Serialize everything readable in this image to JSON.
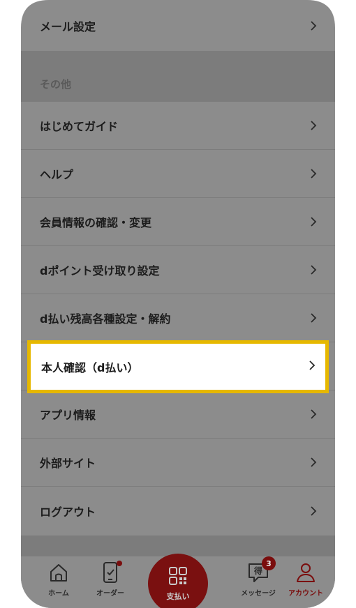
{
  "menu": {
    "top_item": "メール設定",
    "section_title": "その他",
    "items": [
      "はじめてガイド",
      "ヘルプ",
      "会員情報の確認・変更",
      "dポイント受け取り設定",
      "d払い残高各種設定・解約",
      "本人確認（d払い）",
      "アプリ情報",
      "外部サイト",
      "ログアウト"
    ]
  },
  "tabbar": {
    "home": "ホーム",
    "order": "オーダー",
    "pay": "支払い",
    "message": "メッセージ",
    "message_badge": "3",
    "message_icon_char": "得",
    "account": "アカウント"
  },
  "colors": {
    "highlight_border": "#e6b800",
    "accent": "#7a0d0d"
  }
}
